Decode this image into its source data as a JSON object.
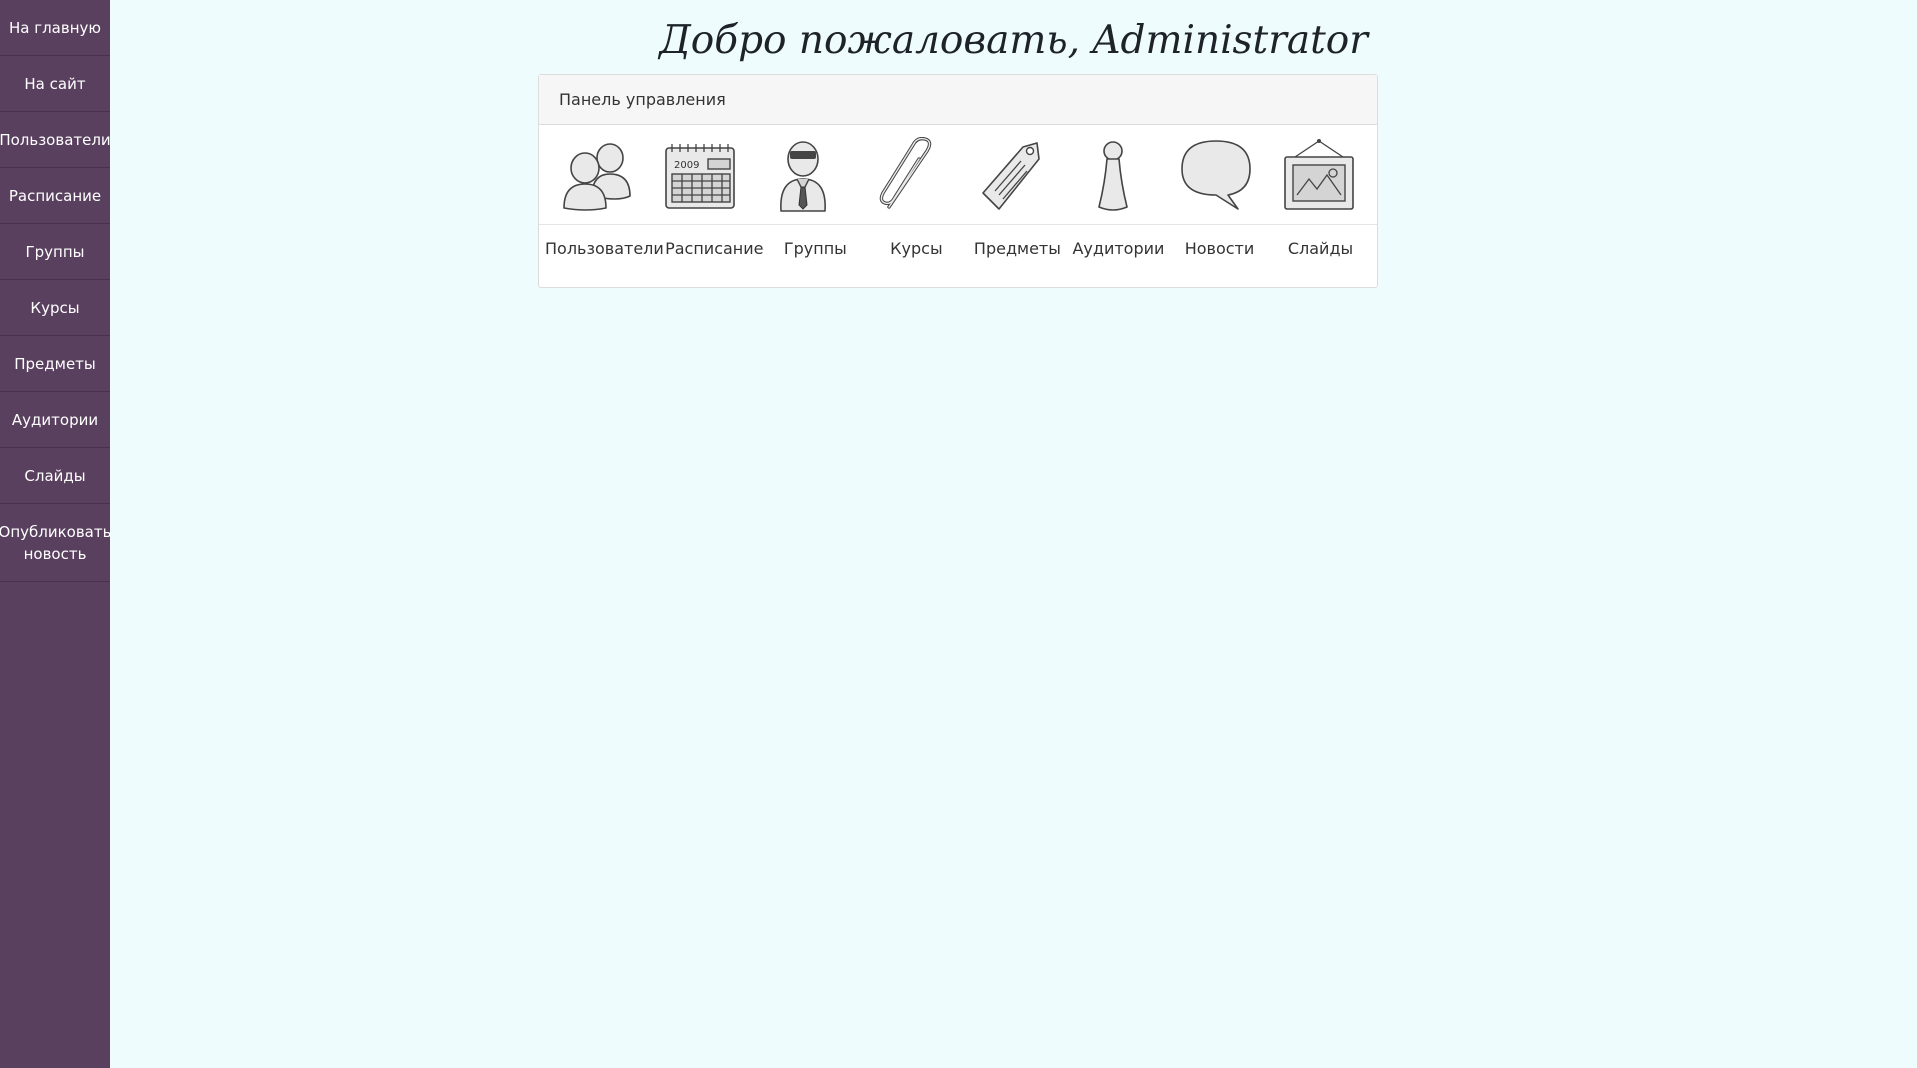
{
  "sidebar": {
    "items": [
      {
        "label": "На главную"
      },
      {
        "label": "На сайт"
      },
      {
        "label": "Пользователи"
      },
      {
        "label": "Расписание"
      },
      {
        "label": "Группы"
      },
      {
        "label": "Курсы"
      },
      {
        "label": "Предметы"
      },
      {
        "label": "Аудитории"
      },
      {
        "label": "Слайды"
      },
      {
        "label": "Опубликовать новость"
      }
    ]
  },
  "main": {
    "title": "Добро пожаловать, Administrator",
    "panel": {
      "header": "Панель управления",
      "calendar_year": "2009",
      "tiles": [
        {
          "label": "Пользователи",
          "icon": "users-icon"
        },
        {
          "label": "Расписание",
          "icon": "calendar-icon"
        },
        {
          "label": "Группы",
          "icon": "group-person-icon"
        },
        {
          "label": "Курсы",
          "icon": "paperclip-icon"
        },
        {
          "label": "Предметы",
          "icon": "tag-icon"
        },
        {
          "label": "Аудитории",
          "icon": "pawn-icon"
        },
        {
          "label": "Новости",
          "icon": "speech-bubble-icon"
        },
        {
          "label": "Слайды",
          "icon": "picture-frame-icon"
        }
      ]
    }
  },
  "colors": {
    "sidebar_bg": "#5a405f",
    "page_bg": "#effcfd",
    "panel_header_bg": "#f6f6f6"
  }
}
